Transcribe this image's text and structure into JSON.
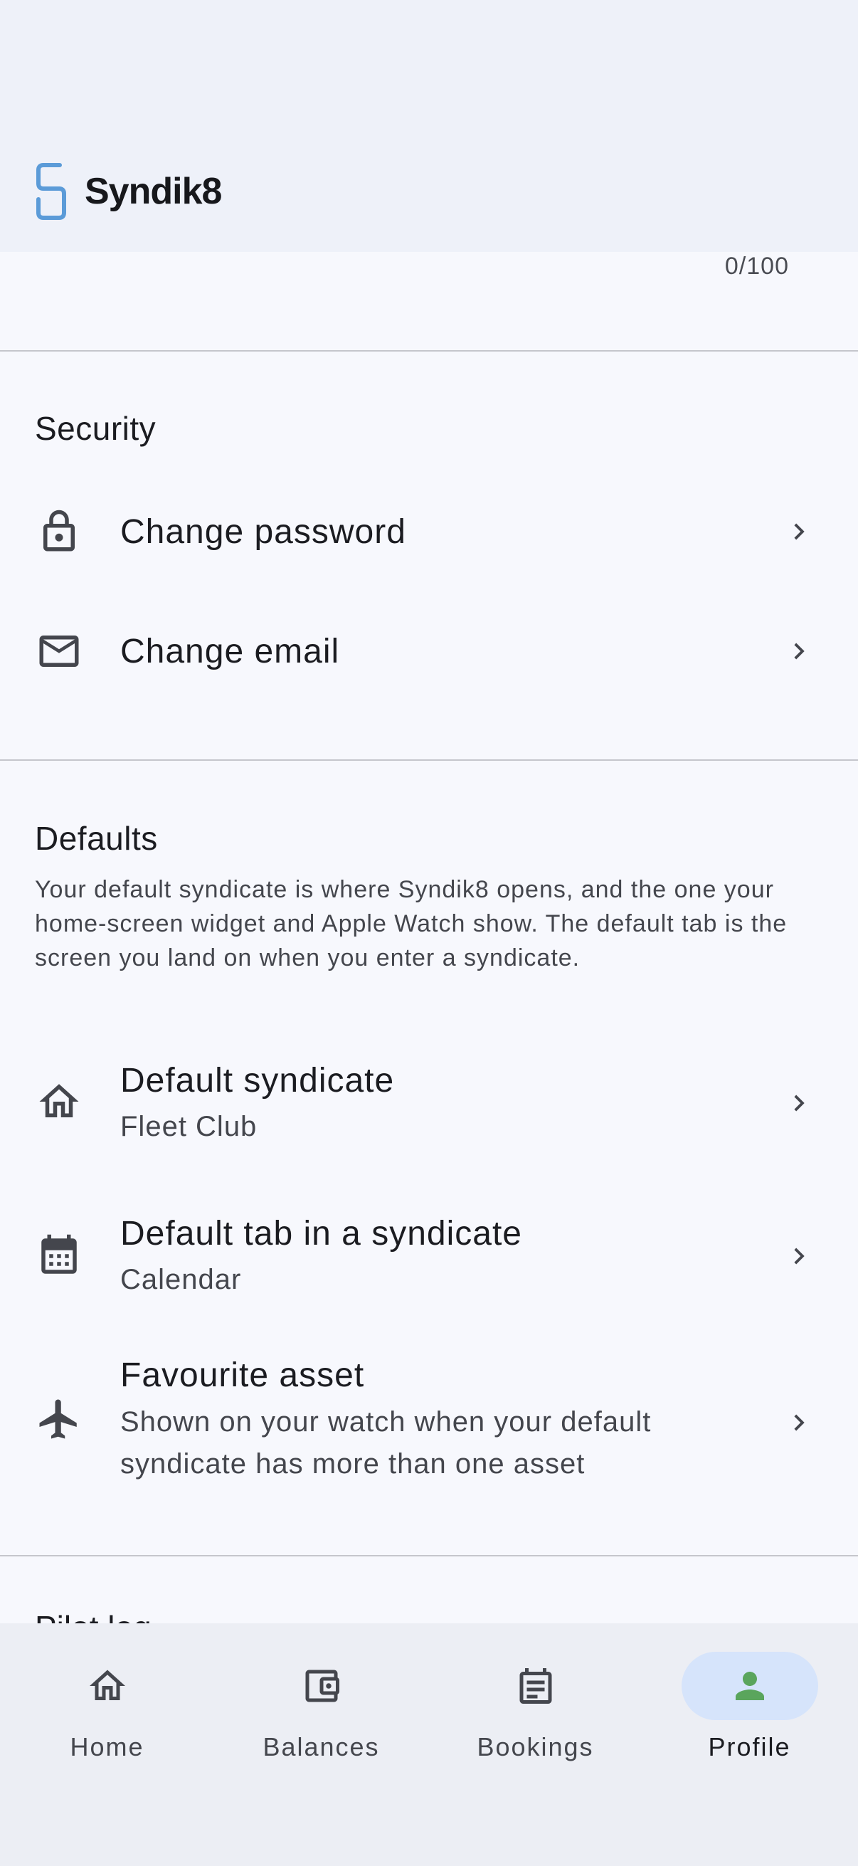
{
  "app": {
    "name": "Syndik8"
  },
  "bio": {
    "counter": "0/100"
  },
  "security": {
    "title": "Security",
    "items": [
      {
        "label": "Change password",
        "icon": "lock-icon"
      },
      {
        "label": "Change email",
        "icon": "mail-icon"
      }
    ]
  },
  "defaults": {
    "title": "Defaults",
    "description": "Your default syndicate is where Syndik8 opens, and the one your home-screen widget and Apple Watch show. The default tab is the screen you land on when you enter a syndicate.",
    "items": [
      {
        "label": "Default syndicate",
        "sub": "Fleet Club",
        "icon": "home-icon"
      },
      {
        "label": "Default tab in a syndicate",
        "sub": "Calendar",
        "icon": "calendar-icon"
      },
      {
        "label": "Favourite asset",
        "sub": "Shown on your watch when your default syndicate has more than one asset",
        "icon": "airplane-icon"
      }
    ]
  },
  "next_section": {
    "title": "Pilot log"
  },
  "nav": {
    "active": "Profile",
    "items": [
      {
        "label": "Home",
        "icon": "home-icon"
      },
      {
        "label": "Balances",
        "icon": "wallet-icon"
      },
      {
        "label": "Bookings",
        "icon": "bookings-icon"
      },
      {
        "label": "Profile",
        "icon": "person-icon"
      }
    ]
  },
  "colors": {
    "brand_blue": "#5b9bd8",
    "active_pill": "#d6e4fb",
    "profile_green": "#5aa55c",
    "background": "#f7f8fd",
    "header_bg": "#eef1f9",
    "nav_bg": "#eceef4"
  }
}
